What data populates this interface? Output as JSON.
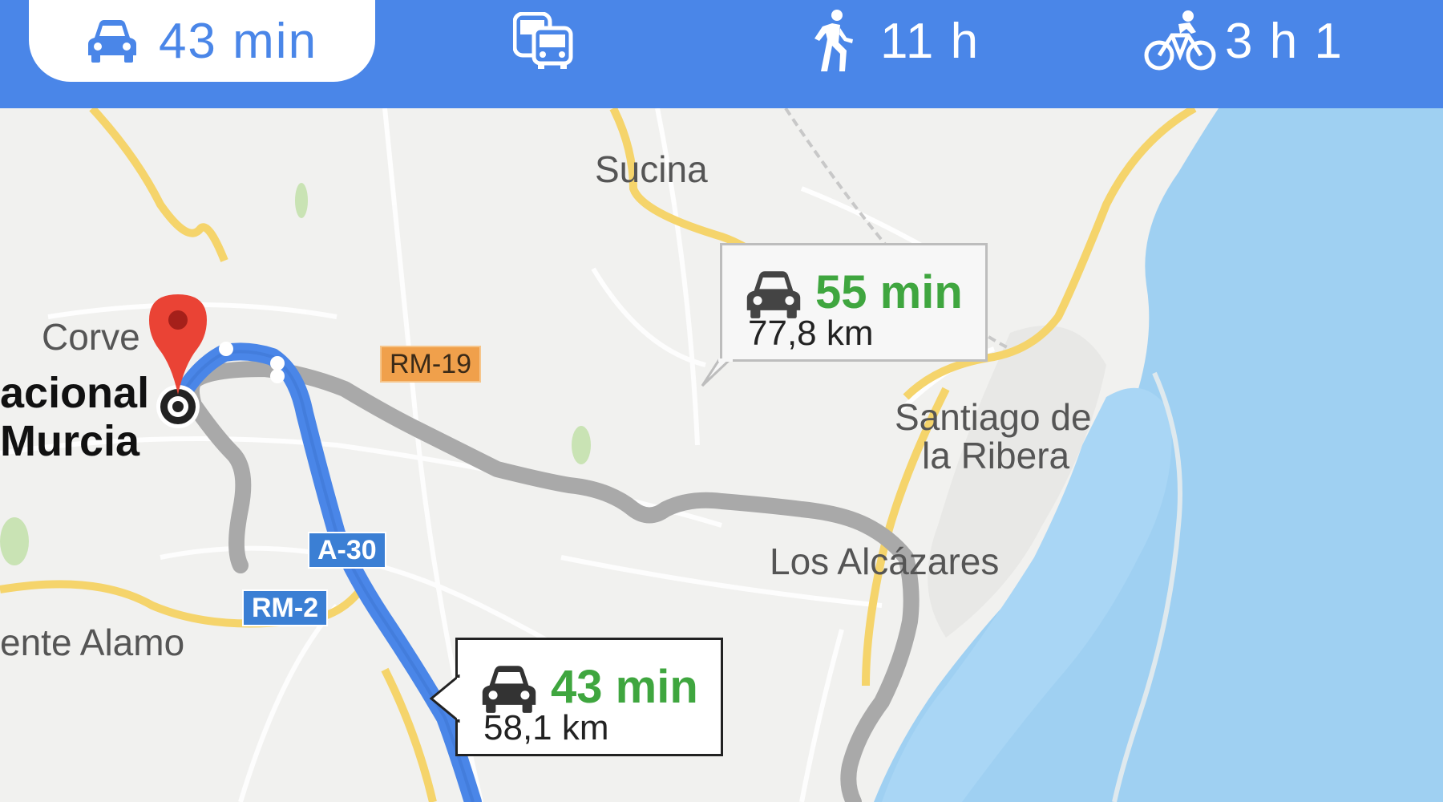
{
  "travel_modes": [
    {
      "name": "Driving",
      "icon": "car-icon",
      "duration": "43 min",
      "selected": true
    },
    {
      "name": "Transit",
      "icon": "transit-icon",
      "duration": "",
      "selected": false
    },
    {
      "name": "Walking",
      "icon": "walking-icon",
      "duration": "11 h",
      "selected": false
    },
    {
      "name": "Cycling",
      "icon": "bicycle-icon",
      "duration": "3 h 1",
      "selected": false
    }
  ],
  "map": {
    "places": {
      "sucina": "Sucina",
      "corvera": "Corve",
      "airport_line1": "acional",
      "airport_line2": "Murcia",
      "santiago_line1": "Santiago de",
      "santiago_line2": "la Ribera",
      "los_alcazares": "Los Alcázares",
      "fuente_alamo": "ente Alamo"
    },
    "road_shields": {
      "rm19": "RM-19",
      "a30": "A-30",
      "rm2": "RM-2"
    },
    "routes": [
      {
        "id": "alternative",
        "duration": "55 min",
        "distance": "77,8 km",
        "selected": false
      },
      {
        "id": "primary",
        "duration": "43 min",
        "distance": "58,1 km",
        "selected": true
      }
    ]
  },
  "colors": {
    "header": "#4a86e8",
    "selected_route": "#4a86e8",
    "alternate_route": "#9e9e9e",
    "sea": "#9fd0f2",
    "duration_text": "#3fa63f",
    "marker": "#ea4335"
  }
}
